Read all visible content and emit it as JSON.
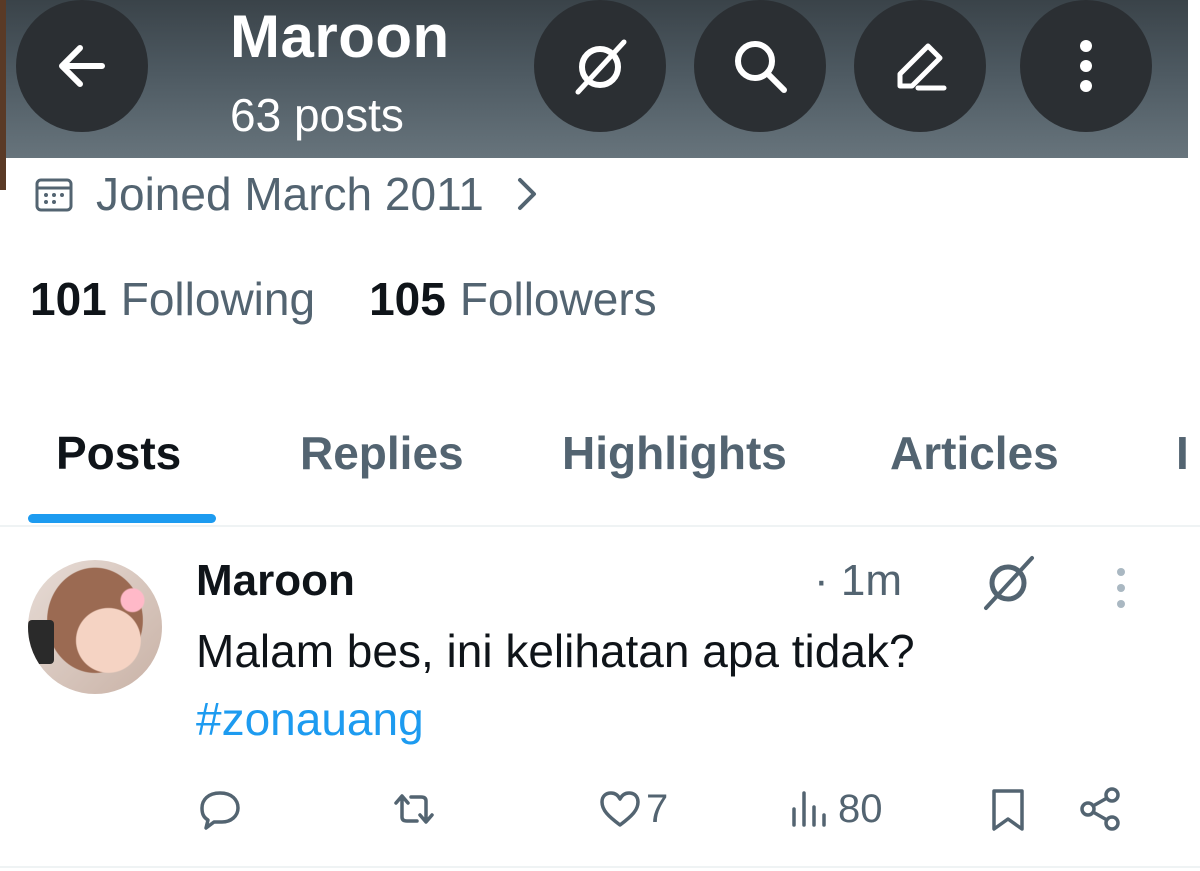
{
  "header": {
    "title": "Maroon",
    "post_count": "63 posts"
  },
  "profile": {
    "joined": "Joined March 2011",
    "following_count": "101",
    "following_label": "Following",
    "followers_count": "105",
    "followers_label": "Followers"
  },
  "tabs": [
    {
      "label": "Posts",
      "active": true
    },
    {
      "label": "Replies",
      "active": false
    },
    {
      "label": "Highlights",
      "active": false
    },
    {
      "label": "Articles",
      "active": false
    },
    {
      "label": "I",
      "active": false
    }
  ],
  "post": {
    "author": "Maroon",
    "time": "· 1m",
    "text": "Malam bes, ini kelihatan apa tidak?",
    "hashtag": "#zonauang",
    "likes": "7",
    "views": "80"
  },
  "icons": {
    "back": "arrow-left-icon",
    "grok": "grok-icon",
    "search": "search-icon",
    "edit": "edit-icon",
    "more": "more-vertical-icon",
    "calendar": "calendar-icon",
    "chevron": "chevron-right-icon",
    "reply": "reply-icon",
    "repost": "repost-icon",
    "like": "heart-icon",
    "views": "views-icon",
    "bookmark": "bookmark-icon",
    "share": "share-icon"
  },
  "colors": {
    "accent": "#1d9bf0",
    "text_primary": "#0f1419",
    "text_secondary": "#536471"
  }
}
